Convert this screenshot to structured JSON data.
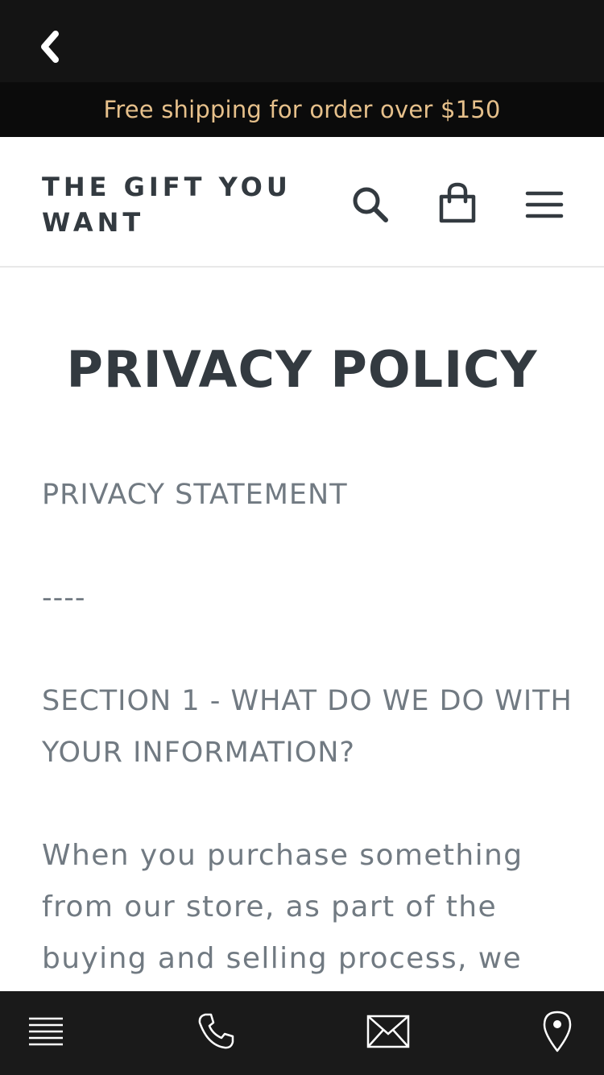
{
  "announcement": {
    "text": "Free shipping for order over $150"
  },
  "header": {
    "logo": "THE GIFT YOU WANT",
    "icons": [
      "search-icon",
      "cart-icon",
      "hamburger-menu-icon"
    ]
  },
  "main": {
    "title": "PRIVACY POLICY",
    "paragraphs": [
      "PRIVACY STATEMENT",
      "----",
      "SECTION 1 - WHAT DO WE DO WITH YOUR INFORMATION?",
      "When you purchase something from our store, as part of the buying and selling process, we collect the personal information"
    ]
  },
  "bottom_bar": {
    "icons": [
      "list-icon",
      "phone-icon",
      "mail-icon",
      "location-pin-icon"
    ]
  },
  "colors": {
    "top_bar": "#141414",
    "announcement_bg": "#0b0b0b",
    "announcement_text": "#e6c08b",
    "heading": "#333a40",
    "body_text": "#717a82",
    "bottom_bar": "#1a1a1a"
  }
}
